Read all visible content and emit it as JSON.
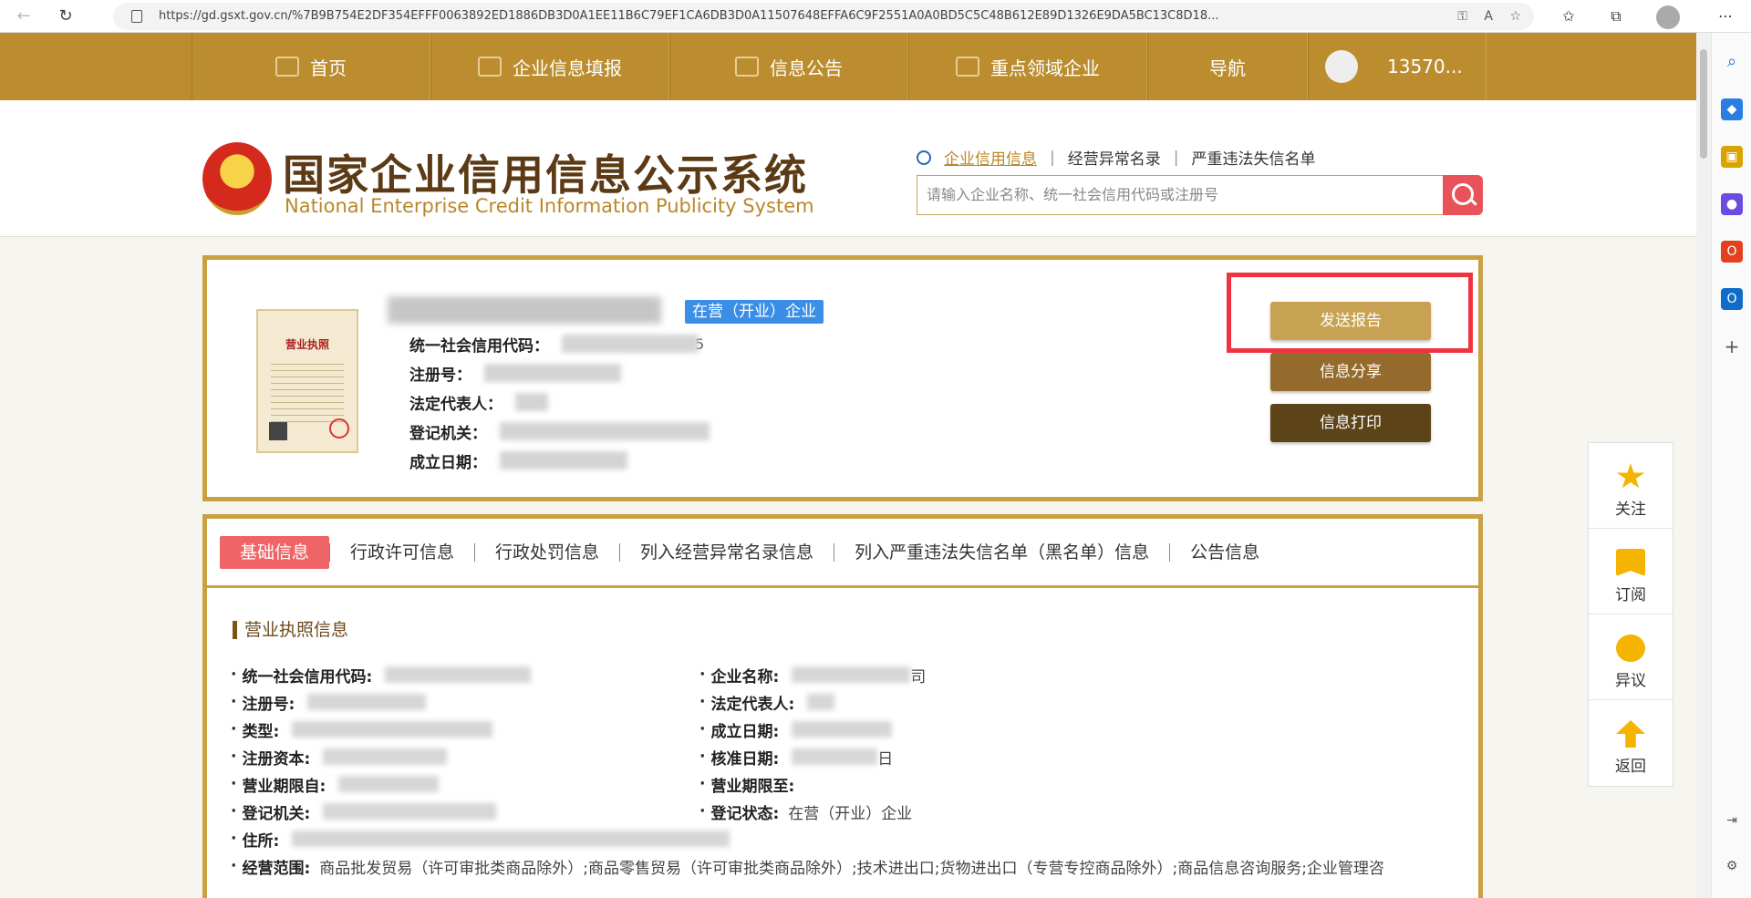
{
  "browser": {
    "url": "https://gd.gsxt.gov.cn/%7B9B754E2DF354EFFF0063892ED1886DB3D0A1EE11B6C79EF1CA6DB3D0A11507648EFFA6C9F2551A0A0BD5C5C48B612E89D1326E9DA5BC13C8D18..."
  },
  "topnav": {
    "items": [
      {
        "label": "首页",
        "icon": "monitor-icon"
      },
      {
        "label": "企业信息填报",
        "icon": "pen-icon"
      },
      {
        "label": "信息公告",
        "icon": "document-icon"
      },
      {
        "label": "重点领域企业",
        "icon": "megaphone-icon"
      },
      {
        "label": "导航",
        "icon": ""
      }
    ],
    "user": "13570..."
  },
  "header": {
    "title_cn": "国家企业信用信息公示系统",
    "title_en": "National Enterprise Credit Information Publicity System",
    "search_tabs": [
      "企业信用信息",
      "经营异常名录",
      "严重违法失信名单"
    ],
    "search_placeholder": "请输入企业名称、统一社会信用代码或注册号"
  },
  "company": {
    "status": "在营（开业）企业",
    "license_title": "营业执照",
    "fields": [
      "统一社会信用代码：",
      "注册号：",
      "法定代表人：",
      "登记机关：",
      "成立日期："
    ],
    "credit_code_suffix": "5",
    "buttons": {
      "send": "发送报告",
      "share": "信息分享",
      "print": "信息打印"
    }
  },
  "float_panel": [
    "关注",
    "订阅",
    "异议",
    "返回"
  ],
  "detail": {
    "tabs": [
      "基础信息",
      "行政许可信息",
      "行政处罚信息",
      "列入经营异常名录信息",
      "列入严重违法失信名单（黑名单）信息",
      "公告信息"
    ],
    "section_title": "营业执照信息",
    "left_fields": [
      "统一社会信用代码:",
      "注册号:",
      "类型:",
      "注册资本:",
      "营业期限自:",
      "登记机关:",
      "住所:"
    ],
    "right_fields": [
      "企业名称:",
      "法定代表人:",
      "成立日期:",
      "核准日期:",
      "营业期限至:",
      "登记状态:"
    ],
    "company_name_suffix": "司",
    "approval_suffix": "日",
    "registration_status": "在营（开业）企业",
    "scope_label": "经营范围:",
    "scope_text": "商品批发贸易（许可审批类商品除外）;商品零售贸易（许可审批类商品除外）;技术进出口;货物进出口（专营专控商品除外）;商品信息咨询服务;企业管理咨"
  }
}
